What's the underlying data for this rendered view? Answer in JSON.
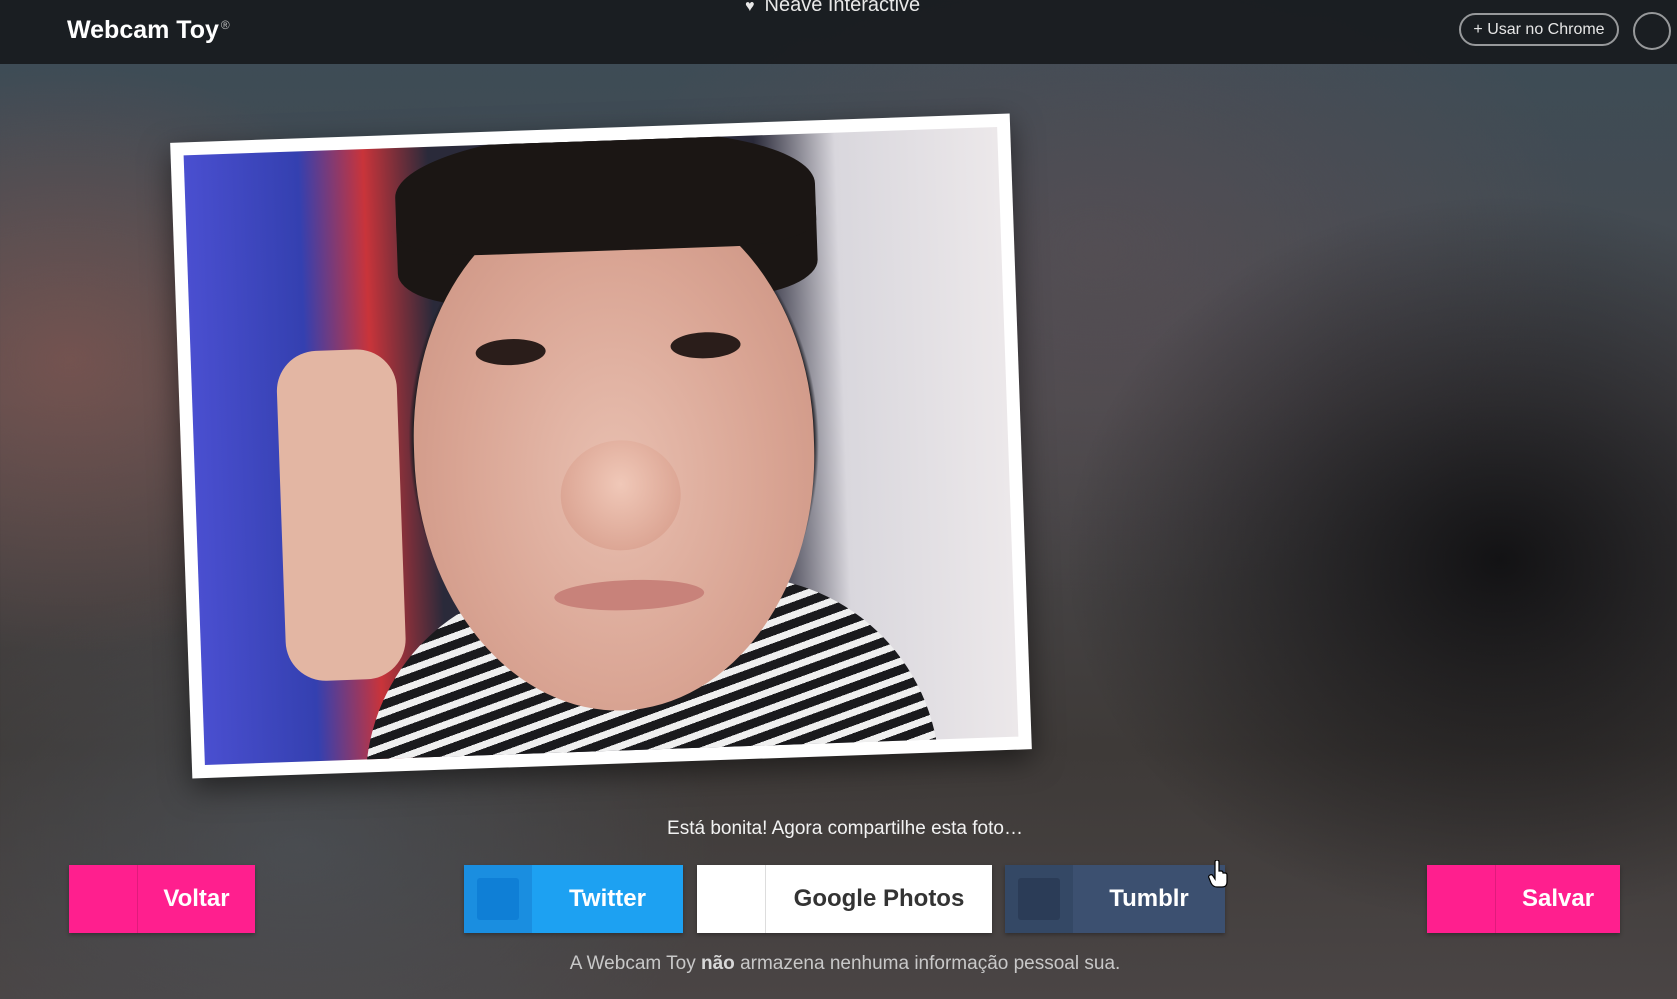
{
  "header": {
    "brand": "Webcam Toy",
    "brand_mark": "®",
    "credit": "Neave Interactive",
    "credit_icon": "heart-icon",
    "chrome_button": "+ Usar no Chrome"
  },
  "photo": {
    "description_icon": "captured-photo"
  },
  "caption": "Está bonita! Agora compartilhe esta foto…",
  "buttons": {
    "back": "Voltar",
    "twitter": "Twitter",
    "google_photos": "Google Photos",
    "tumblr": "Tumblr",
    "save": "Salvar"
  },
  "privacy": {
    "before": "A Webcam Toy",
    "bold": "não",
    "after": "armazena nenhuma informação pessoal sua."
  },
  "colors": {
    "accent_pink": "#ff1f8e",
    "twitter_blue": "#1da1f2",
    "tumblr_navy": "#3c5070"
  }
}
